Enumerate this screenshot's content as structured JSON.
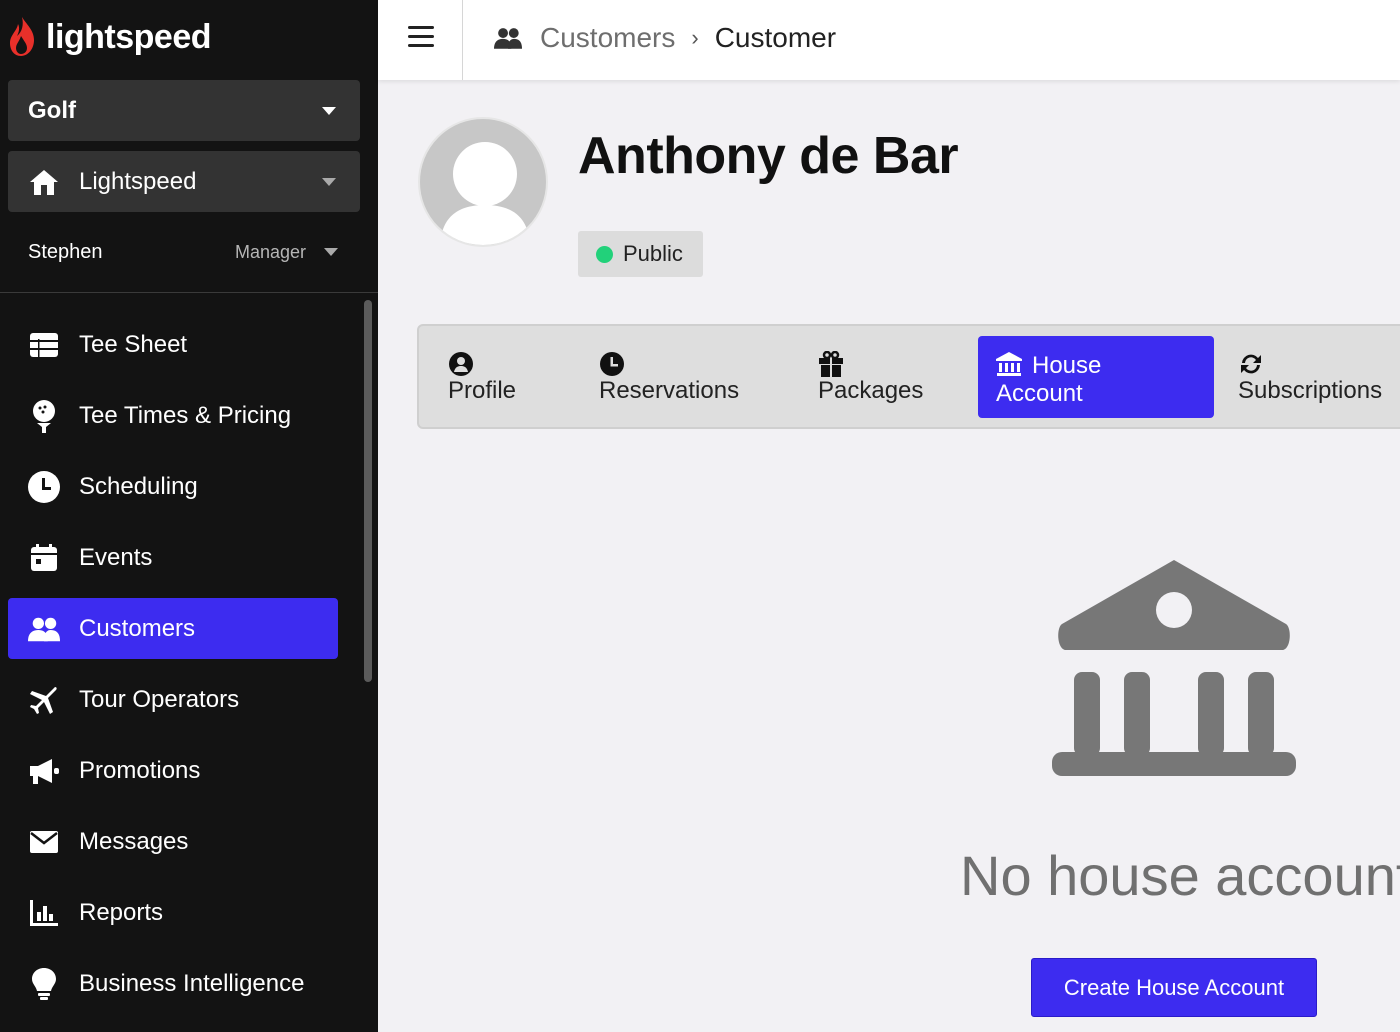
{
  "app": {
    "logo_text": "lightspeed"
  },
  "sidebar": {
    "course_selector": "Golf",
    "location_selector": "Lightspeed",
    "user": {
      "name": "Stephen",
      "role": "Manager"
    },
    "items": [
      {
        "label": "Tee Sheet",
        "icon": "list-icon"
      },
      {
        "label": "Tee Times & Pricing",
        "icon": "golf-ball-tee-icon"
      },
      {
        "label": "Scheduling",
        "icon": "clock-icon"
      },
      {
        "label": "Events",
        "icon": "calendar-icon"
      },
      {
        "label": "Customers",
        "icon": "users-icon",
        "active": true
      },
      {
        "label": "Tour Operators",
        "icon": "plane-icon"
      },
      {
        "label": "Promotions",
        "icon": "megaphone-icon"
      },
      {
        "label": "Messages",
        "icon": "envelope-icon"
      },
      {
        "label": "Reports",
        "icon": "bar-chart-icon"
      },
      {
        "label": "Business Intelligence",
        "icon": "lightbulb-icon"
      }
    ]
  },
  "breadcrumb": {
    "parent": "Customers",
    "current": "Customer"
  },
  "customer": {
    "name": "Anthony de Bar",
    "status": "Public"
  },
  "tabs": [
    {
      "label": "Profile",
      "icon": "user-circle-icon"
    },
    {
      "label": "Reservations",
      "icon": "clock-icon"
    },
    {
      "label": "Packages",
      "icon": "gift-icon"
    },
    {
      "label": "House Account",
      "label_line1": "House",
      "label_line2": "Account",
      "icon": "bank-icon",
      "active": true
    },
    {
      "label": "Subscriptions",
      "icon": "refresh-icon"
    }
  ],
  "empty_state": {
    "message": "No house account",
    "button_label": "Create House Account"
  },
  "colors": {
    "accent": "#3d2cf0",
    "sidebar_bg": "#131313",
    "status_public": "#22d17a"
  }
}
